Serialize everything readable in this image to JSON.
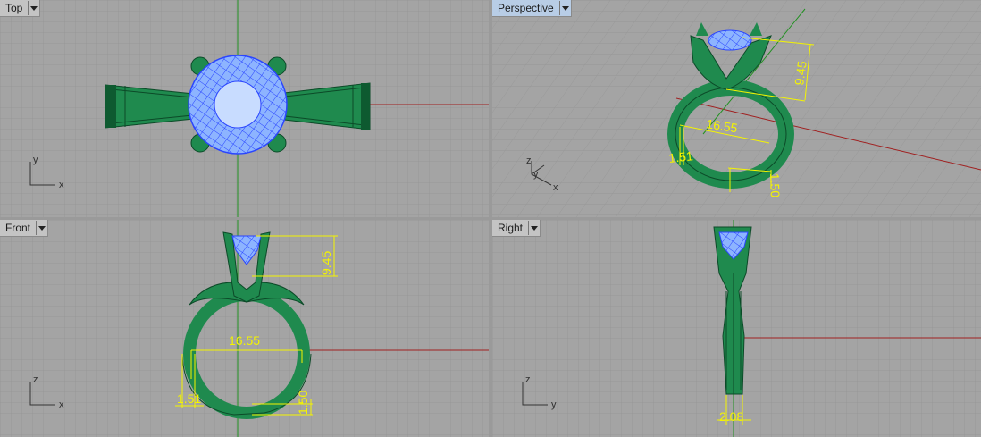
{
  "viewports": {
    "top": {
      "title": "Top",
      "axis_a": "y",
      "axis_b": "x"
    },
    "perspective": {
      "title": "Perspective",
      "axis_a": "z",
      "axis_b": "y",
      "axis_c": "x",
      "dims": {
        "d1": "9.45",
        "d2": "16.55",
        "d3": "1.51",
        "d4": "1.50"
      }
    },
    "front": {
      "title": "Front",
      "axis_a": "z",
      "axis_b": "x",
      "dims": {
        "d1": "9.45",
        "d2": "16.55",
        "d3": "1.51",
        "d4": "1.50"
      }
    },
    "right": {
      "title": "Right",
      "axis_a": "z",
      "axis_b": "y",
      "dims": {
        "d1": "2.08"
      }
    }
  },
  "colors": {
    "viewport_bg": "#a4a4a4",
    "grid": "#9a9a9a",
    "model": "#1f8a4e",
    "gem": "#8db4ff",
    "dimension": "#f4f400",
    "x_axis": "#a02020",
    "y_axis": "#209020",
    "active_tab": "#b8cde6"
  }
}
